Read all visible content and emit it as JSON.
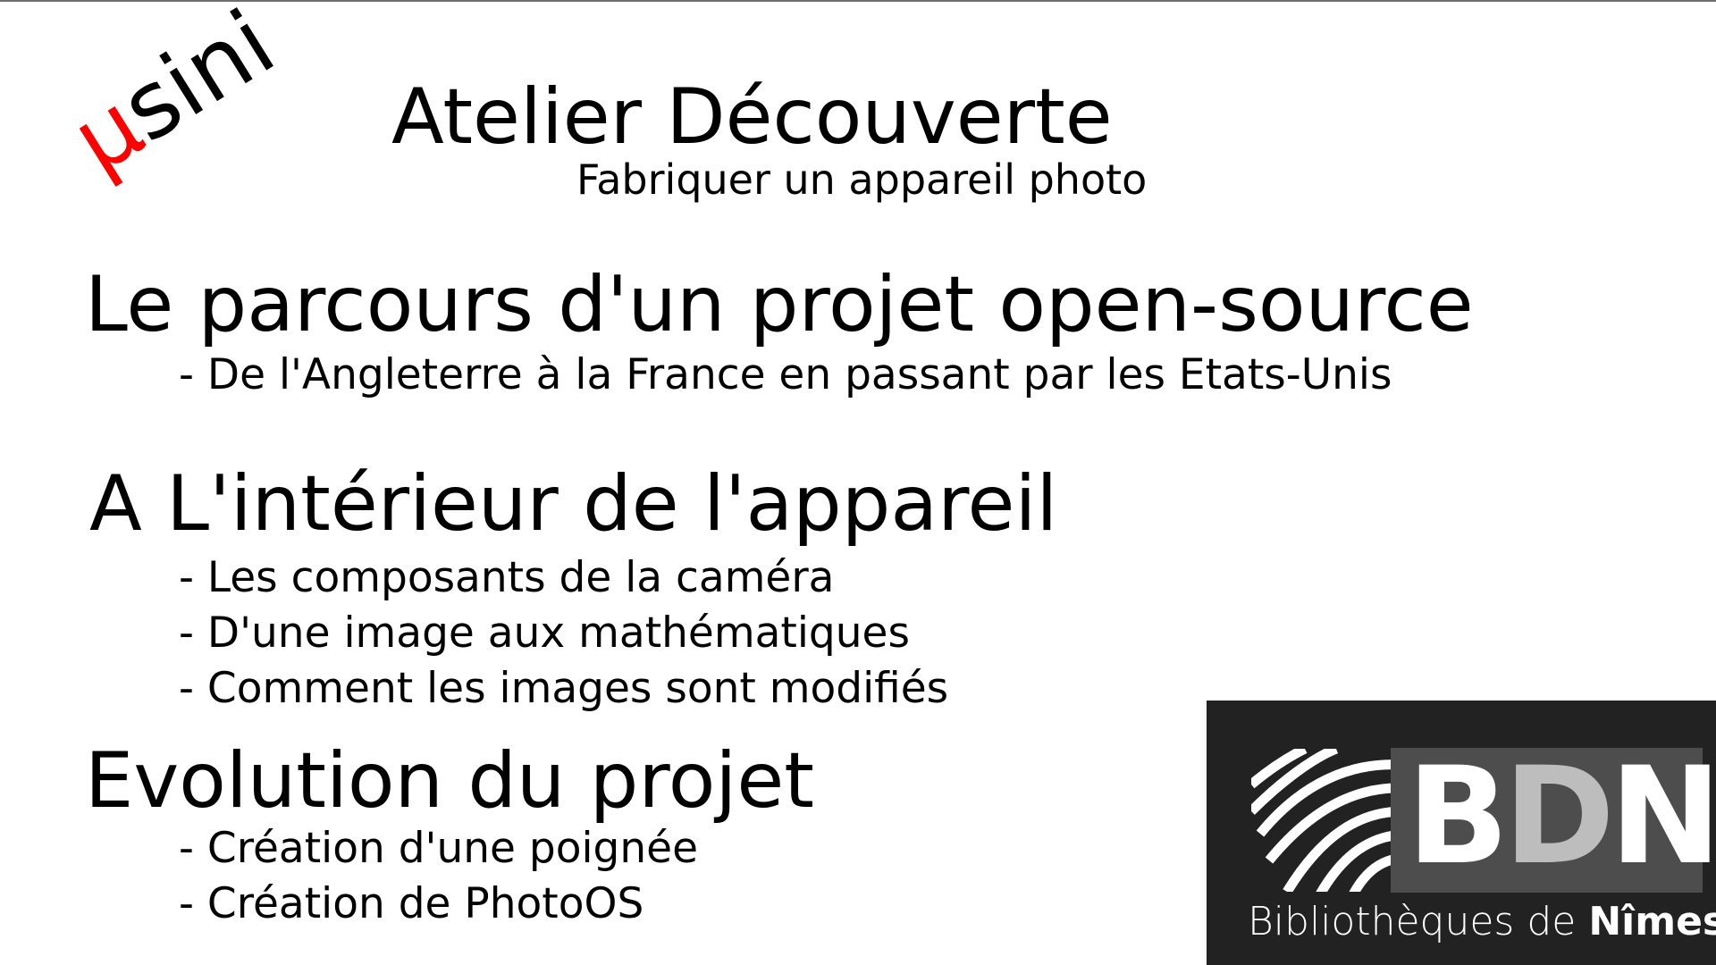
{
  "logo": {
    "mu": "µ",
    "rest": "sini"
  },
  "title": "Atelier Découverte",
  "subtitle": "Fabriquer un appareil photo",
  "sections": [
    {
      "heading": "Le parcours d'un projet open-source",
      "items": [
        "- De l'Angleterre à la France en passant par les Etats-Unis"
      ]
    },
    {
      "heading": "A L'intérieur de l'appareil",
      "items": [
        "- Les composants de la caméra",
        "- D'une image aux mathématiques",
        "- Comment les images sont modifiés"
      ]
    },
    {
      "heading": "Evolution du projet",
      "items": [
        "- Création d'une poignée",
        "- Création de PhotoOS"
      ]
    }
  ],
  "bdn_logo": {
    "letter_b": "B",
    "letter_d": "D",
    "letter_n": "N",
    "caption_prefix": "Bibliothèques de ",
    "caption_city": "Nîmes"
  },
  "colors": {
    "accent": "#ff0000",
    "logo_background": "#222222",
    "logo_panel": "#4d4d4d"
  }
}
